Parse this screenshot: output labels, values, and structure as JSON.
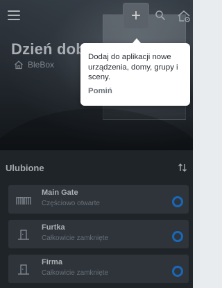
{
  "topbar": {
    "menu_icon": "hamburger-menu-icon",
    "add_label": "+",
    "search_icon": "search-icon",
    "settings_icon": "house-gear-icon"
  },
  "hero": {
    "greeting": "Dzień dobry",
    "home_icon": "home-icon",
    "home_name": "BleBox"
  },
  "tooltip": {
    "text": "Dodaj do aplikacji nowe urządzenia, domy, grupy i sceny.",
    "skip_label": "Pomiń"
  },
  "favorites": {
    "title": "Ulubione",
    "sort_icon": "sort-arrows-icon",
    "devices": [
      {
        "name": "Main Gate",
        "status": "Częściowo otwarte",
        "icon": "gate-icon"
      },
      {
        "name": "Furtka",
        "status": "Całkowicie zamknięte",
        "icon": "door-icon"
      },
      {
        "name": "Firma",
        "status": "Całkowicie zamknięte",
        "icon": "door-icon"
      }
    ]
  },
  "colors": {
    "accent": "#1f7fe0",
    "background": "#272c33",
    "card": "#3a4049",
    "tooltip": "#ffffff"
  }
}
